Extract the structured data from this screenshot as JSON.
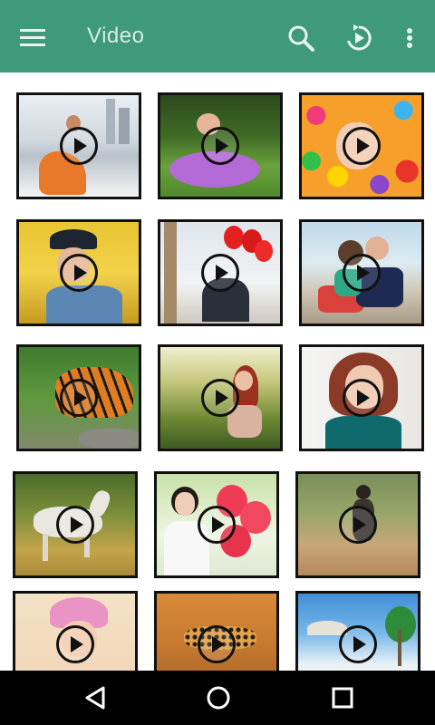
{
  "appbar": {
    "title": "Video",
    "background": "#3e9a7a",
    "icons": [
      "menu-icon",
      "search-icon",
      "replay-icon",
      "more-vert-icon"
    ]
  },
  "videos": [
    {
      "name": "woman-orange-dress-city"
    },
    {
      "name": "baby-purple-tutu-grass"
    },
    {
      "name": "girl-colorful-balls"
    },
    {
      "name": "woman-hat-yellow-car"
    },
    {
      "name": "couple-red-balloons-eiffel"
    },
    {
      "name": "couple-sitting-beach"
    },
    {
      "name": "tiger-jungle"
    },
    {
      "name": "woman-field-sunset"
    },
    {
      "name": "redhead-woman-portrait"
    },
    {
      "name": "white-horse-running"
    },
    {
      "name": "woman-red-balloons"
    },
    {
      "name": "woman-country-road"
    },
    {
      "name": "girl-pink-hat"
    },
    {
      "name": "cheetah-grassland"
    },
    {
      "name": "beach-palm-trees"
    }
  ],
  "navbar": {
    "icons": [
      "back-icon",
      "home-icon",
      "recents-icon"
    ]
  }
}
